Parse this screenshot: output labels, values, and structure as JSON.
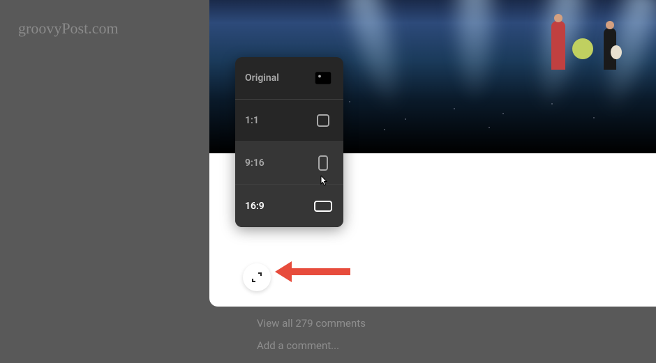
{
  "watermark": "groovyPost.com",
  "ratio_menu": {
    "items": [
      {
        "label": "Original",
        "icon": "original",
        "selected": false,
        "hover": false
      },
      {
        "label": "1:1",
        "icon": "square",
        "selected": false,
        "hover": false
      },
      {
        "label": "9:16",
        "icon": "portrait",
        "selected": false,
        "hover": true
      },
      {
        "label": "16:9",
        "icon": "landscape",
        "selected": true,
        "hover": false
      }
    ]
  },
  "comments": {
    "view_all": "View all 279 comments",
    "add": "Add a comment..."
  },
  "annotation": {
    "arrow_color": "#e74c3c"
  }
}
